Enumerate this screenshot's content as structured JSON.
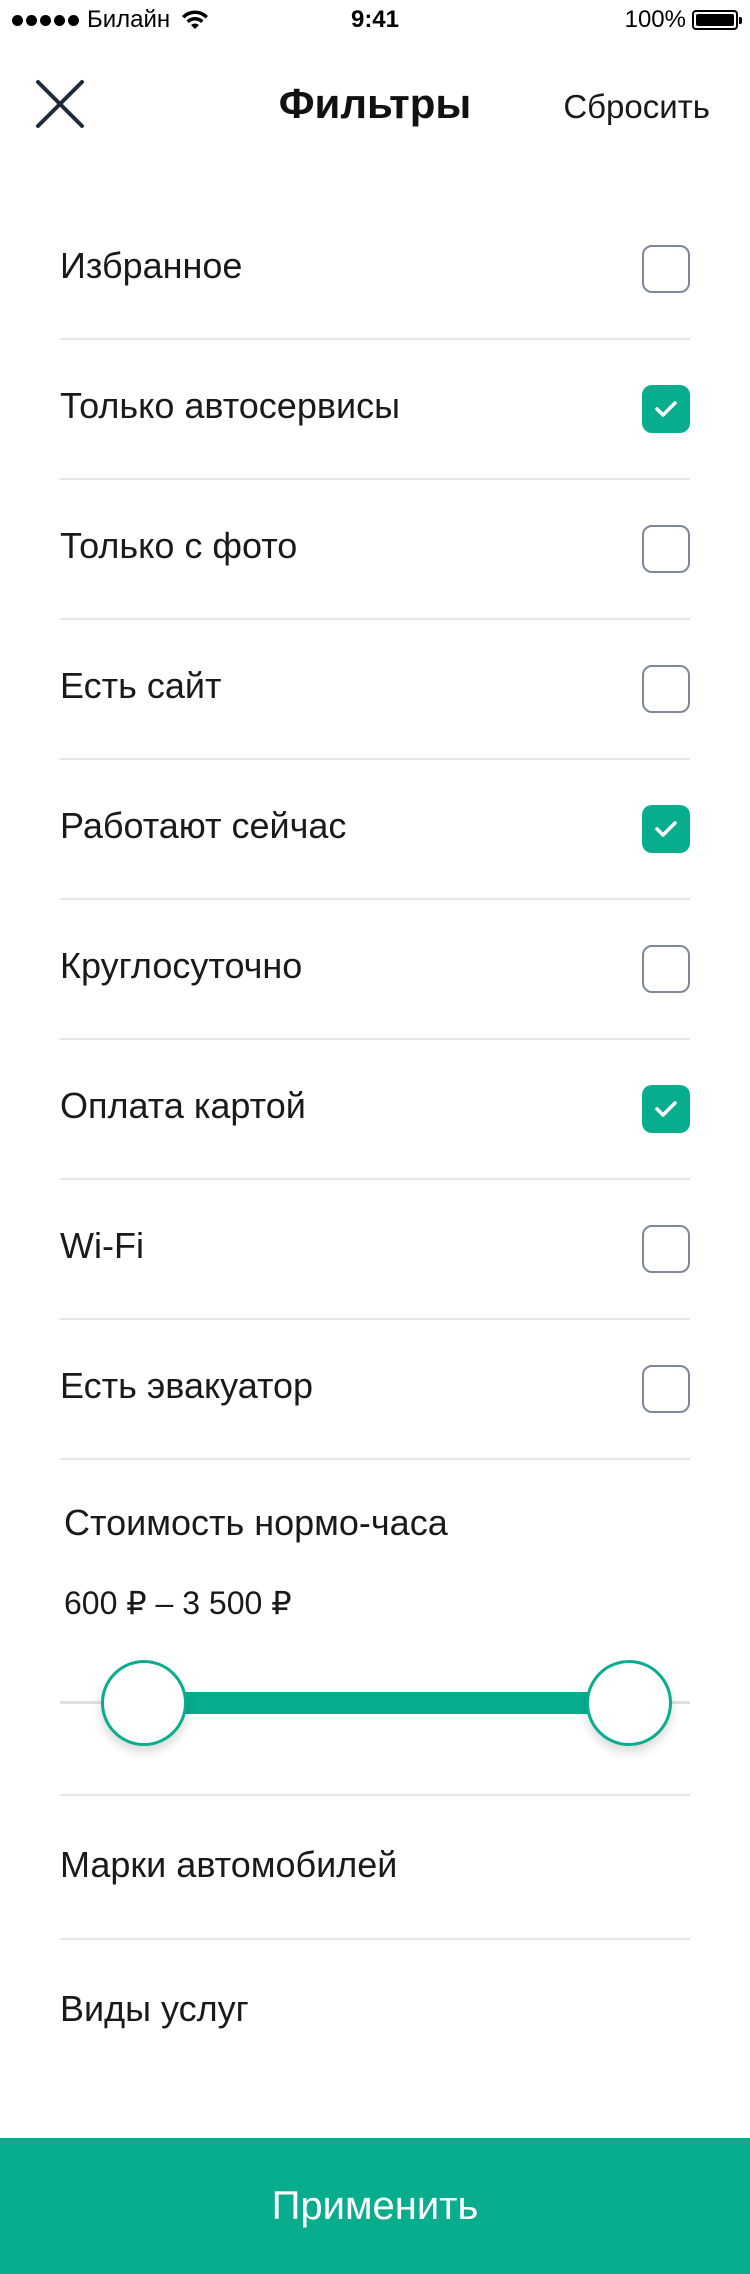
{
  "status_bar": {
    "carrier": "Билайн",
    "time": "9:41",
    "battery": "100%"
  },
  "header": {
    "title": "Фильтры",
    "reset_label": "Сбросить",
    "close_icon": "close-icon"
  },
  "filters": [
    {
      "label": "Избранное",
      "checked": false
    },
    {
      "label": "Только автосервисы",
      "checked": true
    },
    {
      "label": "Только с фото",
      "checked": false
    },
    {
      "label": "Есть сайт",
      "checked": false
    },
    {
      "label": "Работают сейчас",
      "checked": true
    },
    {
      "label": "Круглосуточно",
      "checked": false
    },
    {
      "label": "Оплата картой",
      "checked": true
    },
    {
      "label": "Wi-Fi",
      "checked": false
    },
    {
      "label": "Есть эвакуатор",
      "checked": false
    }
  ],
  "price": {
    "title": "Стоимость нормо-часа",
    "range_text": "600 ₽ – 3 500 ₽"
  },
  "nav_rows": {
    "brands": "Марки автомобилей",
    "services": "Виды услуг"
  },
  "apply_label": "Применить",
  "colors": {
    "accent": "#07ad8d",
    "checkbox_border": "#7f8899",
    "divider": "#e6e6ea"
  }
}
